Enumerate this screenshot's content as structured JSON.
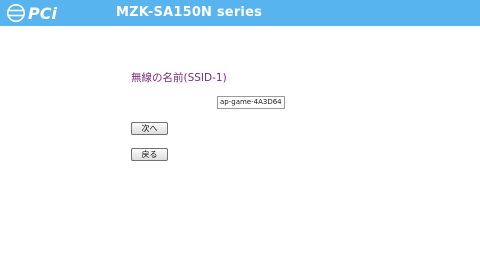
{
  "header": {
    "logo_text": "PCi",
    "title": "MZK-SA150N series",
    "background_color": "#58b4ee"
  },
  "main": {
    "section_title": "無線の名前(SSID-1)",
    "section_title_color": "#7a2c7e",
    "ssid_value": "ap-game-4A3D64",
    "next_button_label": "次へ",
    "back_button_label": "戻る"
  }
}
